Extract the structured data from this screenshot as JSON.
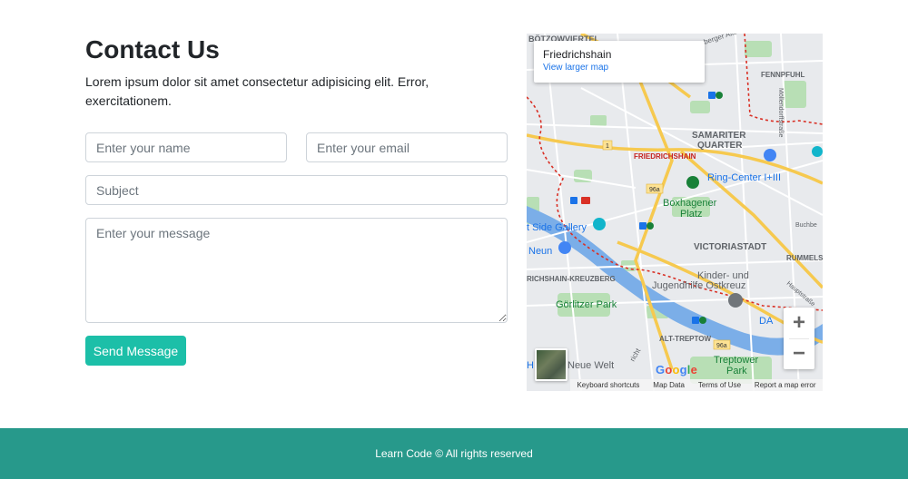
{
  "contact": {
    "title": "Contact Us",
    "description": "Lorem ipsum dolor sit amet consectetur adipisicing elit. Error, exercitationem.",
    "form": {
      "name_placeholder": "Enter your name",
      "email_placeholder": "Enter your email",
      "subject_placeholder": "Subject",
      "message_placeholder": "Enter your message",
      "submit_label": "Send Message"
    }
  },
  "map": {
    "place_name": "Friedrichshain",
    "larger_map_link": "View larger map",
    "labels": {
      "boetzowviertel": "BÖTZOWVIERTEL",
      "fennpfuhl": "FENNPFUHL",
      "samariter": "SAMARITER",
      "quarter": "QUARTER",
      "friedrichshain": "FRIEDRICHSHAIN",
      "ring_center": "Ring-Center I+III",
      "boxhagener": "Boxhagener",
      "platz": "Platz",
      "east_side_gallery": "t Side Gallery",
      "victoriastadt": "VICTORIASTADT",
      "neun": "Neun",
      "rummels": "RUMMELS",
      "friedrichshain_kreuzberg": "RICHSHAIN-KREUZBERG",
      "kinder": "Kinder- und",
      "jugendhilfe": "Jugendhilfe Ostkreuz",
      "goerlitzer": "Görlitzer Park",
      "alt_treptow": "ALT-TREPTOW",
      "neue_welt": "Neue Welt",
      "treptower": "Treptower",
      "park": "Park",
      "da": "DA",
      "h": "H",
      "route_96a": "96a",
      "route_1": "1",
      "buchberger": "Buchbe",
      "muehlsdorfer": "Möllendorffstraße",
      "hauptstrasse": "Hauptstraße",
      "landsberger": "berger Allee",
      "richt": "richt"
    },
    "zoom_in": "+",
    "zoom_out": "−",
    "google_logo": "Google",
    "footer_links": [
      "Keyboard shortcuts",
      "Map Data",
      "Terms of Use",
      "Report a map error"
    ]
  },
  "footer": {
    "text": "Learn Code © All rights reserved"
  },
  "colors": {
    "accent": "#1cbfa8",
    "footer_bg": "#27998b",
    "map_water": "#7baee8",
    "map_park": "#b8dfb5",
    "map_road": "#f6c94f",
    "map_border": "#d93025"
  }
}
